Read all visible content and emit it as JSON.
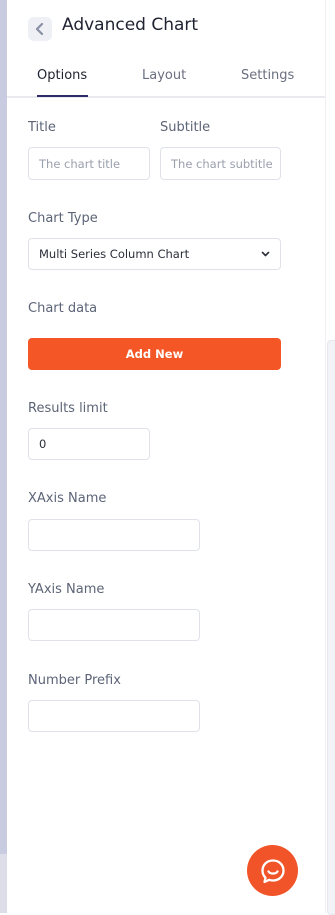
{
  "header": {
    "title": "Advanced Chart"
  },
  "tabs": [
    {
      "label": "Options"
    },
    {
      "label": "Layout"
    },
    {
      "label": "Settings"
    }
  ],
  "form": {
    "title_label": "Title",
    "title_placeholder": "The chart title",
    "subtitle_label": "Subtitle",
    "subtitle_placeholder": "The chart subtitle",
    "chart_type_label": "Chart Type",
    "chart_type_value": "Multi Series Column Chart",
    "chart_data_label": "Chart data",
    "add_new_label": "Add New",
    "results_limit_label": "Results limit",
    "results_limit_value": "0",
    "xaxis_label": "XAxis Name",
    "xaxis_value": "",
    "yaxis_label": "YAxis Name",
    "yaxis_value": "",
    "number_prefix_label": "Number Prefix",
    "number_prefix_value": ""
  },
  "colors": {
    "accent": "#f45626",
    "tab_active_underline": "#2d2c6a",
    "chat_button": "#f2542a"
  },
  "icons": {
    "back": "chevron-left-icon",
    "dropdown": "chevron-down-icon",
    "chat": "chat-bubble-smile-icon"
  }
}
